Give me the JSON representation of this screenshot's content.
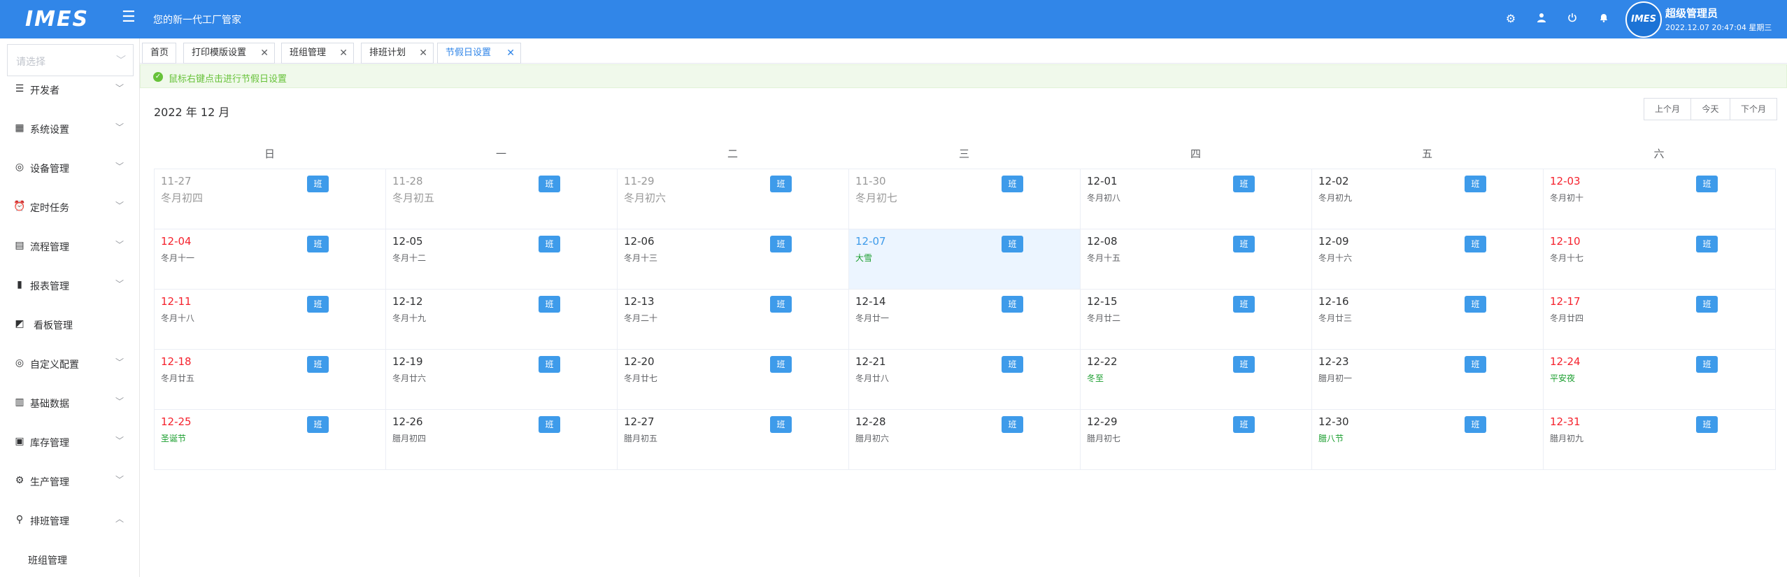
{
  "app": {
    "logo": "IMES",
    "slogan": "您的新一代工厂管家",
    "user_name": "超级管理员",
    "datetime": "2022.12.07 20:47:04 星期三",
    "avatar_text": "IMES",
    "brand_color": "#3186e8"
  },
  "top_icons": [
    "settings-icon",
    "user-icon",
    "power-icon",
    "bell-icon"
  ],
  "sidebar": {
    "select_placeholder": "请选择",
    "items": [
      {
        "label": "开发者",
        "icon": "sliders-icon",
        "chevron": "﹀"
      },
      {
        "label": "系统设置",
        "icon": "grid-icon",
        "chevron": "﹀"
      },
      {
        "label": "设备管理",
        "icon": "cog-circle-icon",
        "chevron": "﹀"
      },
      {
        "label": "定时任务",
        "icon": "alarm-icon",
        "chevron": "﹀"
      },
      {
        "label": "流程管理",
        "icon": "flow-icon",
        "chevron": "﹀"
      },
      {
        "label": "报表管理",
        "icon": "bar-chart-icon",
        "chevron": "﹀"
      },
      {
        "label": "看板管理",
        "icon": "dashboard-icon",
        "chevron": ""
      },
      {
        "label": "自定义配置",
        "icon": "custom-icon",
        "chevron": "﹀"
      },
      {
        "label": "基础数据",
        "icon": "book-icon",
        "chevron": "﹀"
      },
      {
        "label": "库存管理",
        "icon": "clipboard-icon",
        "chevron": "﹀"
      },
      {
        "label": "生产管理",
        "icon": "gear-icon",
        "chevron": "﹀"
      },
      {
        "label": "排班管理",
        "icon": "person-icon",
        "chevron": "︿"
      }
    ],
    "sub_item": "班组管理"
  },
  "tabs": [
    {
      "label": "首页",
      "closable": false
    },
    {
      "label": "打印模版设置",
      "closable": true
    },
    {
      "label": "班组管理",
      "closable": true
    },
    {
      "label": "排班计划",
      "closable": true
    },
    {
      "label": "节假日设置",
      "closable": true,
      "active": true
    }
  ],
  "alert": {
    "message": "鼠标右键点击进行节假日设置"
  },
  "calendar": {
    "title": "2022 年 12 月",
    "buttons": [
      "上个月",
      "今天",
      "下个月"
    ],
    "weekdays": [
      "日",
      "一",
      "二",
      "三",
      "四",
      "五",
      "六"
    ],
    "shift_label": "班",
    "weeks": [
      [
        {
          "date": "11-27",
          "lunar": "冬月初四",
          "type": "other"
        },
        {
          "date": "11-28",
          "lunar": "冬月初五",
          "type": "other"
        },
        {
          "date": "11-29",
          "lunar": "冬月初六",
          "type": "other"
        },
        {
          "date": "11-30",
          "lunar": "冬月初七",
          "type": "other"
        },
        {
          "date": "12-01",
          "lunar": "冬月初八",
          "type": "normal"
        },
        {
          "date": "12-02",
          "lunar": "冬月初九",
          "type": "normal"
        },
        {
          "date": "12-03",
          "lunar": "冬月初十",
          "type": "weekend"
        }
      ],
      [
        {
          "date": "12-04",
          "lunar": "冬月十一",
          "type": "weekend"
        },
        {
          "date": "12-05",
          "lunar": "冬月十二",
          "type": "normal"
        },
        {
          "date": "12-06",
          "lunar": "冬月十三",
          "type": "normal"
        },
        {
          "date": "12-07",
          "lunar": "大雪",
          "type": "today",
          "festival": true
        },
        {
          "date": "12-08",
          "lunar": "冬月十五",
          "type": "normal"
        },
        {
          "date": "12-09",
          "lunar": "冬月十六",
          "type": "normal"
        },
        {
          "date": "12-10",
          "lunar": "冬月十七",
          "type": "weekend"
        }
      ],
      [
        {
          "date": "12-11",
          "lunar": "冬月十八",
          "type": "weekend"
        },
        {
          "date": "12-12",
          "lunar": "冬月十九",
          "type": "normal"
        },
        {
          "date": "12-13",
          "lunar": "冬月二十",
          "type": "normal"
        },
        {
          "date": "12-14",
          "lunar": "冬月廿一",
          "type": "normal"
        },
        {
          "date": "12-15",
          "lunar": "冬月廿二",
          "type": "normal"
        },
        {
          "date": "12-16",
          "lunar": "冬月廿三",
          "type": "normal"
        },
        {
          "date": "12-17",
          "lunar": "冬月廿四",
          "type": "weekend"
        }
      ],
      [
        {
          "date": "12-18",
          "lunar": "冬月廿五",
          "type": "weekend"
        },
        {
          "date": "12-19",
          "lunar": "冬月廿六",
          "type": "normal"
        },
        {
          "date": "12-20",
          "lunar": "冬月廿七",
          "type": "normal"
        },
        {
          "date": "12-21",
          "lunar": "冬月廿八",
          "type": "normal"
        },
        {
          "date": "12-22",
          "lunar": "冬至",
          "type": "normal",
          "festival": true
        },
        {
          "date": "12-23",
          "lunar": "腊月初一",
          "type": "normal"
        },
        {
          "date": "12-24",
          "lunar": "平安夜",
          "type": "weekend",
          "festival": true
        }
      ],
      [
        {
          "date": "12-25",
          "lunar": "圣诞节",
          "type": "weekend",
          "festival": true
        },
        {
          "date": "12-26",
          "lunar": "腊月初四",
          "type": "normal"
        },
        {
          "date": "12-27",
          "lunar": "腊月初五",
          "type": "normal"
        },
        {
          "date": "12-28",
          "lunar": "腊月初六",
          "type": "normal"
        },
        {
          "date": "12-29",
          "lunar": "腊月初七",
          "type": "normal"
        },
        {
          "date": "12-30",
          "lunar": "腊八节",
          "type": "normal",
          "festival": true
        },
        {
          "date": "12-31",
          "lunar": "腊月初九",
          "type": "weekend"
        }
      ]
    ]
  }
}
